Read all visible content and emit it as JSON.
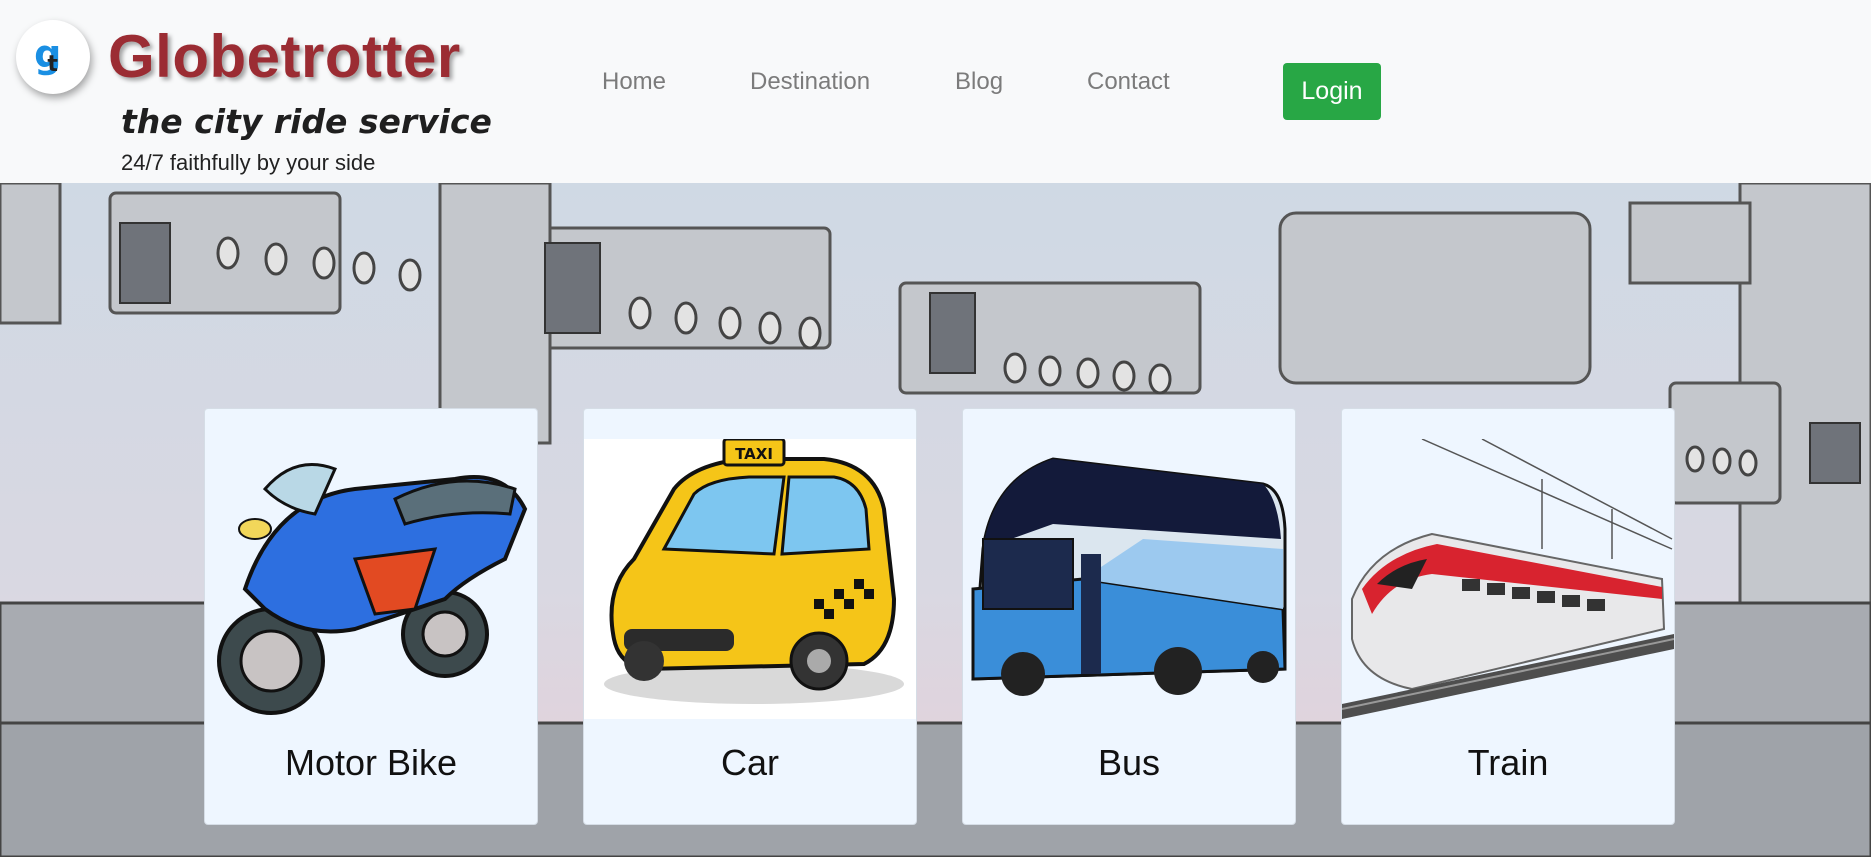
{
  "brand": {
    "logo_letter": "g",
    "logo_letter_2": "t",
    "title": "Globetrotter",
    "subtitle": "the city ride service",
    "tagline": "24/7 faithfully by your side"
  },
  "nav": {
    "items": [
      "Home",
      "Destination",
      "Blog",
      "Contact"
    ],
    "login_label": "Login"
  },
  "colors": {
    "brand_title": "#9b2c33",
    "login_button": "#28a745",
    "card_background": "#eef6ff",
    "nav_text": "#7b7b7b"
  },
  "cards": [
    {
      "label": "Motor Bike",
      "icon": "motorbike-image"
    },
    {
      "label": "Car",
      "icon": "taxi-car-image"
    },
    {
      "label": "Bus",
      "icon": "bus-image"
    },
    {
      "label": "Train",
      "icon": "train-image"
    }
  ],
  "taxi_sign": "TAXI"
}
